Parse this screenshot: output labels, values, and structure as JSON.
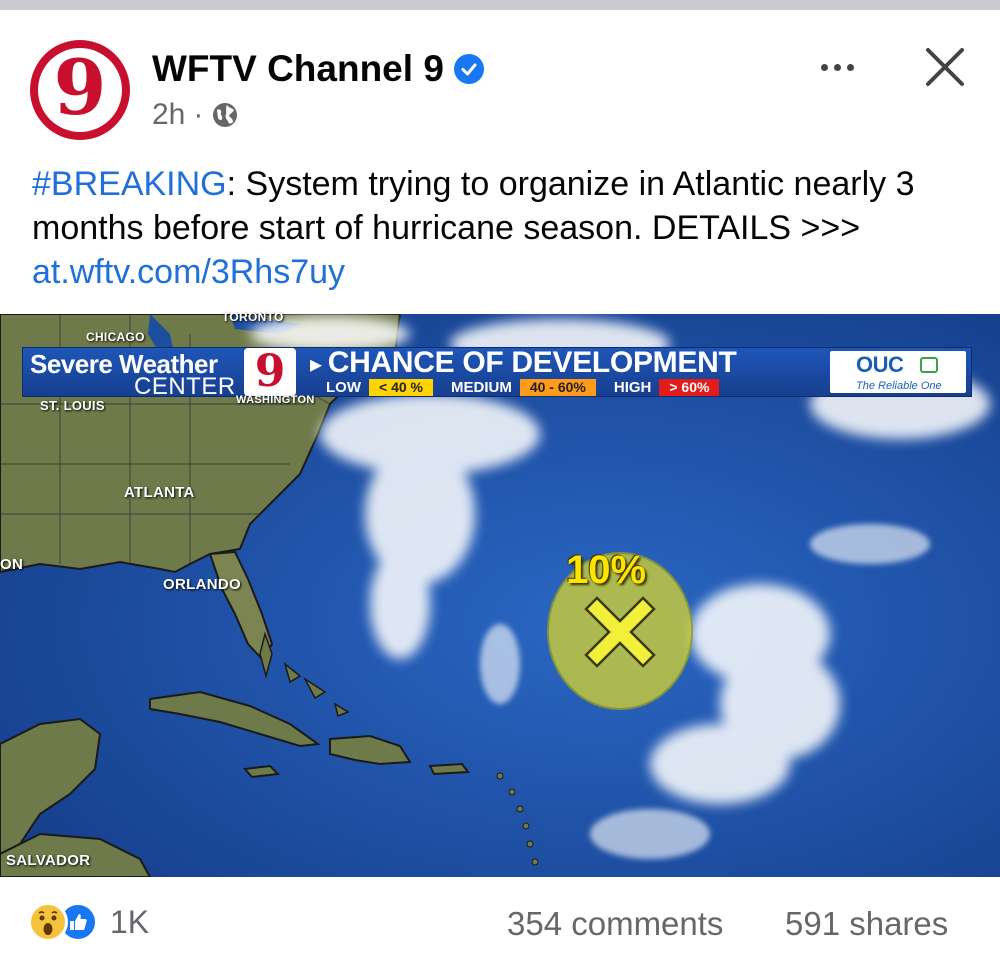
{
  "post": {
    "page_name": "WFTV Channel 9",
    "avatar_text": "9",
    "time": "2h",
    "separator": "·",
    "text": {
      "hashtag": "#BREAKING",
      "body": ": System trying to organize in Atlantic nearly 3 months before start of hurricane season. DETAILS >>> ",
      "link": "at.wftv.com/3Rhs7uy"
    }
  },
  "image": {
    "banner": {
      "title": "Severe Weather",
      "subtitle": "CENTER",
      "logo": "9",
      "heading": "CHANCE OF DEVELOPMENT",
      "levels": [
        {
          "label": "LOW",
          "range": "< 40 %",
          "color": "#ffd400"
        },
        {
          "label": "MEDIUM",
          "range": "40 - 60%",
          "color": "#ff9b1a"
        },
        {
          "label": "HIGH",
          "range": "> 60%",
          "color": "#e31b1b"
        }
      ],
      "sponsor": "OUC",
      "sponsor_tagline": "The Reliable One"
    },
    "cities": {
      "toronto": "TORONTO",
      "chicago": "CHICAGO",
      "st_louis": "ST. LOUIS",
      "washington": "WASHINGTON",
      "atlanta": "ATLANTA",
      "orlando": "ORLANDO",
      "houston_partial": "ON",
      "el_salvador_partial": "SALVADOR"
    },
    "outlook": {
      "percent": "10%",
      "marker": "X",
      "area_color": "#c9cc3a"
    }
  },
  "footer": {
    "reactions": [
      "wow",
      "like"
    ],
    "reaction_count": "1K",
    "comments": "354 comments",
    "shares": "591 shares"
  },
  "colors": {
    "link": "#216fdb",
    "secondary_text": "#65676b",
    "brand_red": "#c8102e",
    "verified_blue": "#1877f2",
    "banner_blue": "#1f56b8"
  }
}
